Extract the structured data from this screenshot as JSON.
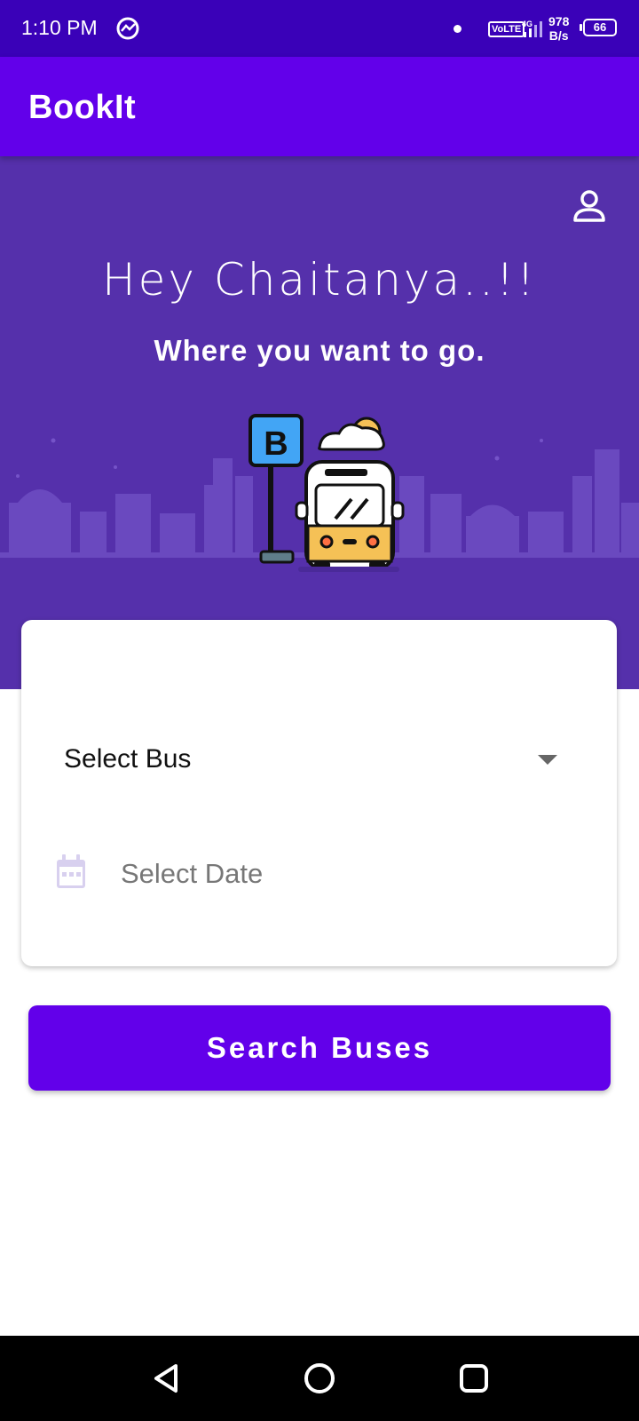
{
  "status_bar": {
    "time": "1:10 PM",
    "network_type": "VoLTE",
    "network_gen": "4G",
    "speed_value": "978",
    "speed_unit": "B/s",
    "battery": "66"
  },
  "app_bar": {
    "title": "BookIt"
  },
  "hero": {
    "greeting": "Hey Chaitanya..!!",
    "subtitle": "Where you want to go.",
    "bus_stop_sign": "B",
    "icons": {
      "profile": "person-icon"
    }
  },
  "form": {
    "bus_select": {
      "selected_value": "Select Bus"
    },
    "date_field": {
      "placeholder": "Select Date",
      "icon": "calendar-icon"
    }
  },
  "search_button": {
    "label": "Search Buses"
  },
  "nav_bar": {
    "icons": [
      "back-icon",
      "home-icon",
      "recents-icon"
    ]
  },
  "colors": {
    "status_bar": "#3a01b8",
    "primary": "#6200ea",
    "hero_background": "#5530ab"
  }
}
